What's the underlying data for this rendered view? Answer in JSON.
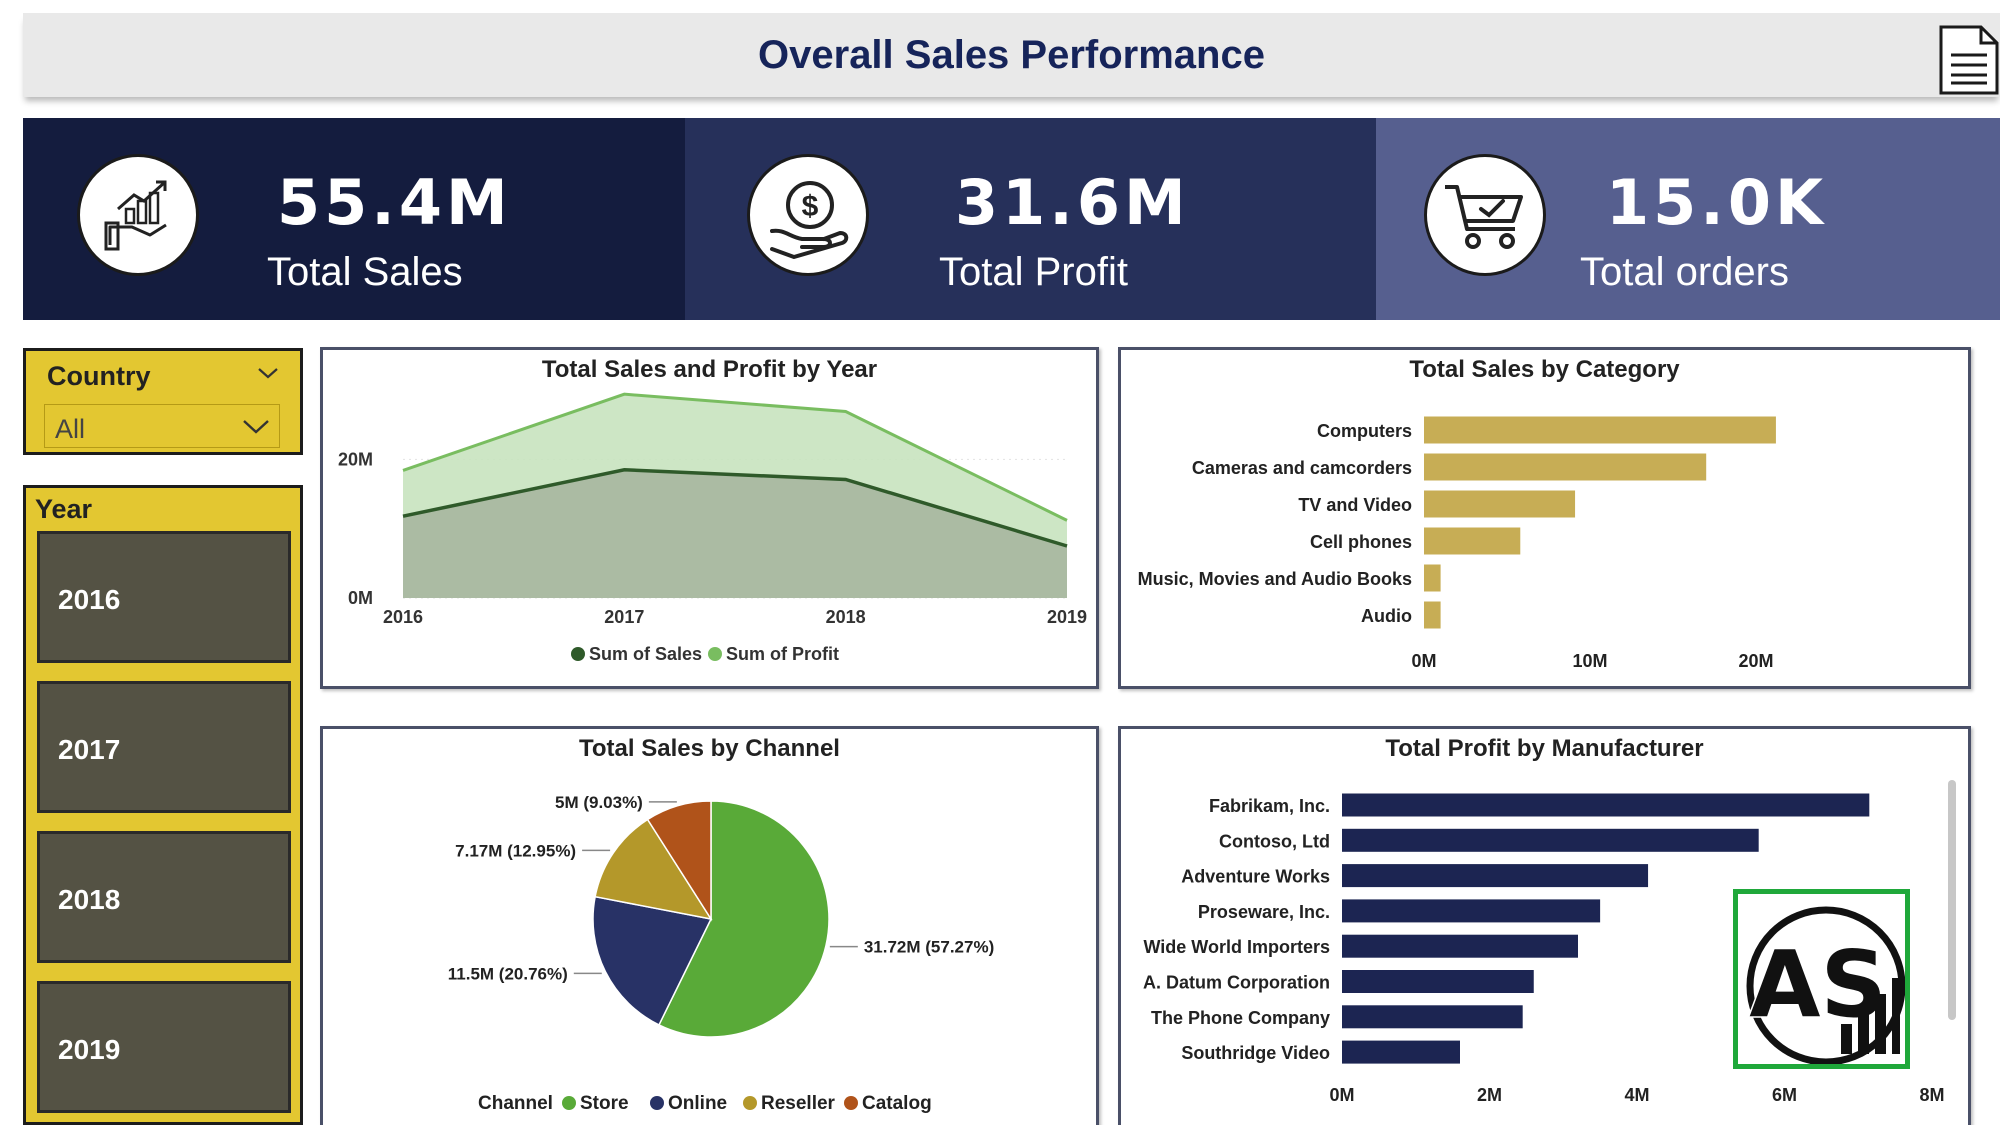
{
  "header": {
    "title": "Overall Sales Performance",
    "report_icon": "document-icon"
  },
  "kpis": [
    {
      "value": "55.4M",
      "label": "Total Sales",
      "icon": "growth-hand-icon"
    },
    {
      "value": "31.6M",
      "label": "Total Profit",
      "icon": "dollar-hand-icon"
    },
    {
      "value": "15.0K",
      "label": "Total orders",
      "icon": "shopping-cart-icon"
    }
  ],
  "slicers": {
    "country": {
      "title": "Country",
      "value": "All"
    },
    "year": {
      "title": "Year",
      "options": [
        "2016",
        "2017",
        "2018",
        "2019"
      ]
    }
  },
  "colors": {
    "header_title": "#16245a",
    "kpi_1": "#141c3e",
    "kpi_2": "#26305a",
    "kpi_3": "#565f8f",
    "slicer": "#e3c731",
    "slicer_button": "#545244",
    "sales_line": "#2f5a2a",
    "sales_area": "#a9b8a1",
    "profit_line": "#79bd60",
    "profit_area": "#c8e3bf",
    "category_bar": "#c7ad55",
    "manufacturer_bar": "#1c2552",
    "store": "#59aa38",
    "online": "#283266",
    "reseller": "#b4982a",
    "catalog": "#b0531a",
    "logo_border": "#1fa83a"
  },
  "charts": {
    "sales_profit_by_year": {
      "title": "Total Sales and Profit by Year"
    },
    "sales_by_category": {
      "title": "Total Sales by Category"
    },
    "sales_by_channel": {
      "title": "Total Sales by Channel"
    },
    "profit_by_manufacturer": {
      "title": "Total Profit by Manufacturer"
    }
  },
  "chart_data": [
    {
      "type": "area",
      "title": "Total Sales and Profit by Year",
      "x": [
        "2016",
        "2017",
        "2018",
        "2019"
      ],
      "series": [
        {
          "name": "Sum of Sales",
          "values": [
            11.8,
            18.5,
            17.1,
            7.5
          ]
        },
        {
          "name": "Sum of Profit",
          "values": [
            18.4,
            29.4,
            26.9,
            11.2
          ]
        }
      ],
      "ylim": [
        0,
        30
      ],
      "yticks": [
        "0M",
        "20M"
      ],
      "tick_values": [
        0,
        20
      ],
      "legend": "bottom"
    },
    {
      "type": "bar",
      "orientation": "horizontal",
      "title": "Total Sales by Category",
      "categories": [
        "Computers",
        "Cameras and camcorders",
        "TV and Video",
        "Cell phones",
        "Music, Movies and Audio Books",
        "Audio"
      ],
      "values": [
        21.2,
        17.0,
        9.1,
        5.8,
        1.0,
        1.0
      ],
      "xlim": [
        0,
        25
      ],
      "xticks": [
        "0M",
        "10M",
        "20M"
      ],
      "tick_values": [
        0,
        10,
        20
      ]
    },
    {
      "type": "pie",
      "title": "Total Sales by Channel",
      "legend_title": "Channel",
      "categories": [
        "Store",
        "Online",
        "Reseller",
        "Catalog"
      ],
      "values": [
        31.72,
        11.5,
        7.17,
        5.0
      ],
      "percents": [
        57.27,
        20.76,
        12.95,
        9.03
      ],
      "labels": [
        "31.72M (57.27%)",
        "11.5M (20.76%)",
        "7.17M (12.95%)",
        "5M (9.03%)"
      ],
      "legend": "bottom"
    },
    {
      "type": "bar",
      "orientation": "horizontal",
      "title": "Total Profit by Manufacturer",
      "categories": [
        "Fabrikam, Inc.",
        "Contoso, Ltd",
        "Adventure Works",
        "Proseware, Inc.",
        "Wide World Importers",
        "A. Datum Corporation",
        "The Phone Company",
        "Southridge Video"
      ],
      "values": [
        7.15,
        5.65,
        4.15,
        3.5,
        3.2,
        2.6,
        2.45,
        1.6
      ],
      "xlim": [
        0,
        8
      ],
      "xticks": [
        "0M",
        "2M",
        "4M",
        "6M",
        "8M"
      ],
      "tick_values": [
        0,
        2,
        4,
        6,
        8
      ]
    }
  ],
  "logo": {
    "text": "AS"
  }
}
